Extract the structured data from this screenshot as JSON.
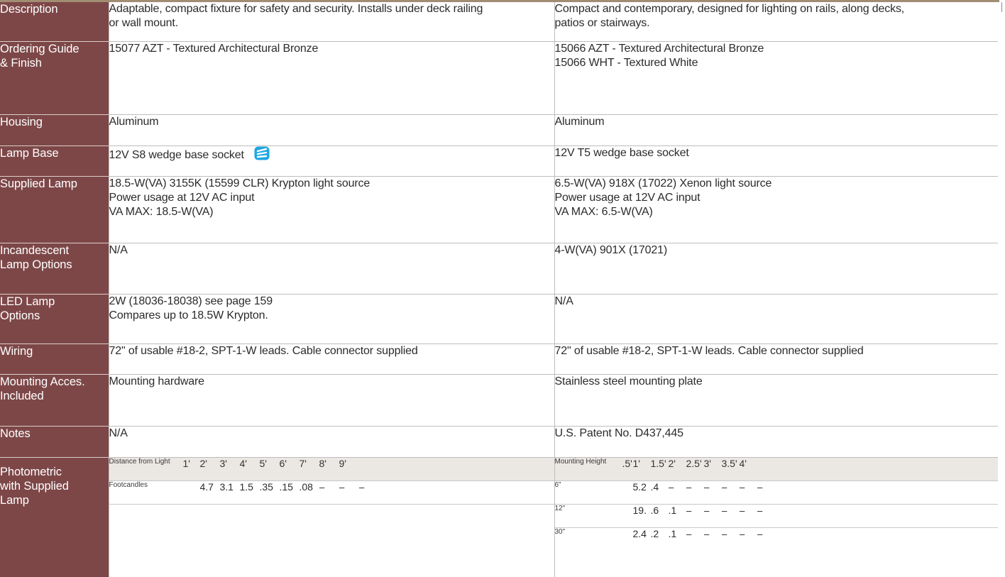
{
  "rows": [
    {
      "label": "Description",
      "left": [
        "Adaptable, compact fixture for safety and security. Installs under deck railing",
        "or wall mount."
      ],
      "right": [
        "Compact and contemporary, designed for lighting on rails, along decks,",
        "patios or stairways."
      ]
    },
    {
      "label": [
        "Ordering Guide",
        "& Finish"
      ],
      "left": [
        "15077 AZT - Textured Architectural Bronze"
      ],
      "right": [
        "15066 AZT - Textured Architectural Bronze",
        "15066 WHT - Textured White"
      ]
    },
    {
      "label": "Housing",
      "left": [
        "Aluminum"
      ],
      "right": [
        "Aluminum"
      ]
    },
    {
      "label": "Lamp Base",
      "left": [
        "12V  S8 wedge base socket"
      ],
      "right": [
        "12V  T5 wedge base socket"
      ]
    },
    {
      "label": "Supplied Lamp",
      "left": [
        "18.5-W(VA) 3155K (15599 CLR) Krypton light source",
        "Power usage at 12V AC input",
        "VA MAX: 18.5-W(VA)"
      ],
      "right": [
        "6.5-W(VA) 918X (17022) Xenon light source",
        "Power usage at 12V AC input",
        "VA MAX: 6.5-W(VA)"
      ]
    },
    {
      "label": [
        "Incandescent",
        "Lamp Options"
      ],
      "left": [
        "N/A"
      ],
      "right": [
        "4-W(VA) 901X (17021)"
      ]
    },
    {
      "label": [
        "LED Lamp",
        "Options"
      ],
      "left": [
        "2W (18036-18038) see page 159",
        "Compares up to 18.5W Krypton."
      ],
      "right": [
        "N/A"
      ]
    },
    {
      "label": "Wiring",
      "left": [
        "72\" of usable #18-2, SPT-1-W leads. Cable connector supplied"
      ],
      "right": [
        "72\" of usable #18-2, SPT-1-W leads. Cable connector supplied"
      ]
    },
    {
      "label": [
        "Mounting Acces.",
        "Included"
      ],
      "left": [
        "Mounting hardware"
      ],
      "right": [
        "Stainless steel mounting plate"
      ]
    },
    {
      "label": "Notes",
      "left": [
        "N/A"
      ],
      "right": [
        "U.S. Patent No. D437,445"
      ]
    },
    {
      "label": [
        "Photometric",
        "with Supplied",
        "Lamp"
      ]
    }
  ],
  "wedge_icon": {
    "name": "wedge-base-icon",
    "color": "#1ea7e1"
  },
  "photometric": {
    "left": {
      "header_label": "Distance from Light",
      "header_values": [
        "1'",
        "2'",
        "3'",
        "4'",
        "5'",
        "6'",
        "7'",
        "8'",
        "9'"
      ],
      "rows": [
        {
          "label": "Footcandles",
          "values": [
            "4.7",
            "3.1",
            "1.5",
            ".35",
            ".15",
            ".08",
            "–",
            "–",
            "–"
          ]
        }
      ]
    },
    "right": {
      "header_label": "Mounting Height",
      "header_values": [
        ".5'",
        "1'",
        "1.5'",
        "2'",
        "2.5'",
        "3'",
        "3.5'",
        "4'"
      ],
      "rows": [
        {
          "label": "6\"",
          "values": [
            "5.2",
            ".4",
            "–",
            "–",
            "–",
            "–",
            "–",
            "–"
          ]
        },
        {
          "label": "12\"",
          "values": [
            "19.",
            ".6",
            ".1",
            "–",
            "–",
            "–",
            "–",
            "–"
          ]
        },
        {
          "label": "30\"",
          "values": [
            "2.4",
            ".2",
            ".1",
            "–",
            "–",
            "–",
            "–",
            "–"
          ]
        }
      ]
    }
  },
  "colors": {
    "label_bg": "#7d4748",
    "header_bg": "#ebe7e3",
    "top_bar": "#a08d72"
  }
}
